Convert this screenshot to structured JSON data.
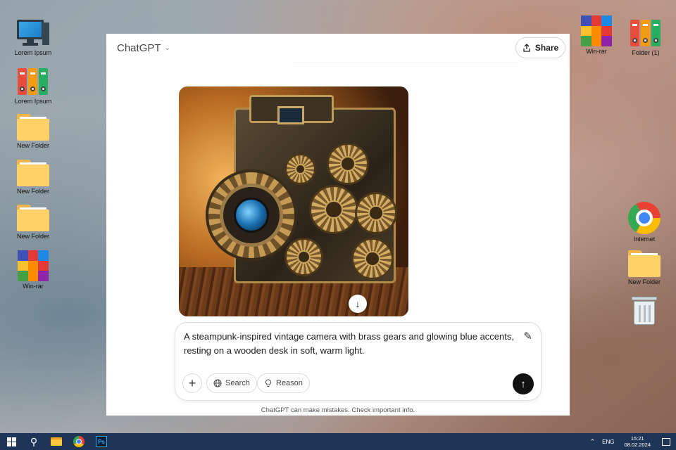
{
  "desktop": {
    "left_icons": [
      {
        "label": "Lorem Ipsum",
        "icon": "computer-icon"
      },
      {
        "label": "Lorem Ipsum",
        "icon": "binders-icon"
      },
      {
        "label": "New Folder",
        "icon": "folder-icon"
      },
      {
        "label": "New Folder",
        "icon": "folder-icon"
      },
      {
        "label": "New Folder",
        "icon": "folder-icon"
      },
      {
        "label": "Win-rar",
        "icon": "winrar-icon"
      }
    ],
    "right_icons": [
      {
        "label": "Win-rar",
        "icon": "winrar-icon"
      },
      {
        "label": "Folder (1)",
        "icon": "binders-icon"
      },
      {
        "label": "Internet",
        "icon": "chrome-icon"
      },
      {
        "label": "New Folder",
        "icon": "folder-icon"
      },
      {
        "label": "",
        "icon": "recycle-bin-icon"
      }
    ]
  },
  "chat": {
    "app_title": "ChatGPT",
    "share_label": "Share",
    "image_alt_icon": "download-icon",
    "prompt_text": "A steampunk-inspired vintage camera with brass gears and glowing blue accents, resting on a wooden desk in soft, warm light.",
    "search_label": "Search",
    "reason_label": "Reason",
    "disclaimer": "ChatGPT can make mistakes. Check important info."
  },
  "taskbar": {
    "language": "ENG",
    "time": "15:21",
    "date": "08.02.2024"
  },
  "colors": {
    "taskbar_bg": "#1f3557",
    "send_button": "#111111",
    "window_bg": "#ffffff"
  }
}
